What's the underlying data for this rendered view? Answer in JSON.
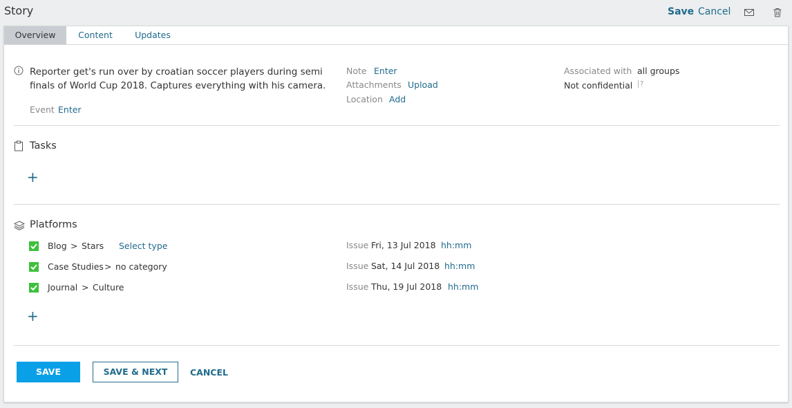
{
  "header": {
    "title": "Story",
    "save_label": "Save",
    "cancel_label": "Cancel"
  },
  "tabs": [
    {
      "label": "Overview",
      "active": true
    },
    {
      "label": "Content",
      "active": false
    },
    {
      "label": "Updates",
      "active": false
    }
  ],
  "overview": {
    "description": "Reporter get's run over by croatian soccer players during semi finals of World Cup 2018. Captures everything with his camera.",
    "event_label": "Event",
    "event_action": "Enter",
    "note_label": "Note",
    "note_action": "Enter",
    "attachments_label": "Attachments",
    "attachments_action": "Upload",
    "location_label": "Location",
    "location_action": "Add",
    "associated_label": "Associated with",
    "associated_value": "all groups",
    "confidential_value": "Not confidential",
    "help_mark": "?"
  },
  "tasks": {
    "title": "Tasks",
    "add": "+"
  },
  "platforms": {
    "title": "Platforms",
    "add": "+",
    "separator": ">",
    "issue_label": "Issue",
    "items": [
      {
        "platform": "Blog",
        "category": "Stars",
        "type_action": "Select type",
        "issue_date": "Fri, 13 Jul 2018",
        "time": "hh:mm",
        "checked": true
      },
      {
        "platform": "Case Studies",
        "category": "no category",
        "type_action": "",
        "issue_date": "Sat, 14 Jul 2018",
        "time": "hh:mm",
        "checked": true
      },
      {
        "platform": "Journal",
        "category": "Culture",
        "type_action": "",
        "issue_date": "Thu, 19 Jul 2018",
        "time": "hh:mm",
        "checked": true
      }
    ]
  },
  "footer": {
    "save": "SAVE",
    "save_next": "SAVE & NEXT",
    "cancel": "CANCEL"
  },
  "colors": {
    "accent": "#1f6a8c",
    "primary_button": "#0aa0e8",
    "checkbox": "#3cc13c"
  },
  "icons": {
    "mail": "mail-icon",
    "trash": "trash-icon",
    "info": "info-icon",
    "tasks": "clipboard-icon",
    "platforms": "layers-icon",
    "check": "check-icon"
  }
}
